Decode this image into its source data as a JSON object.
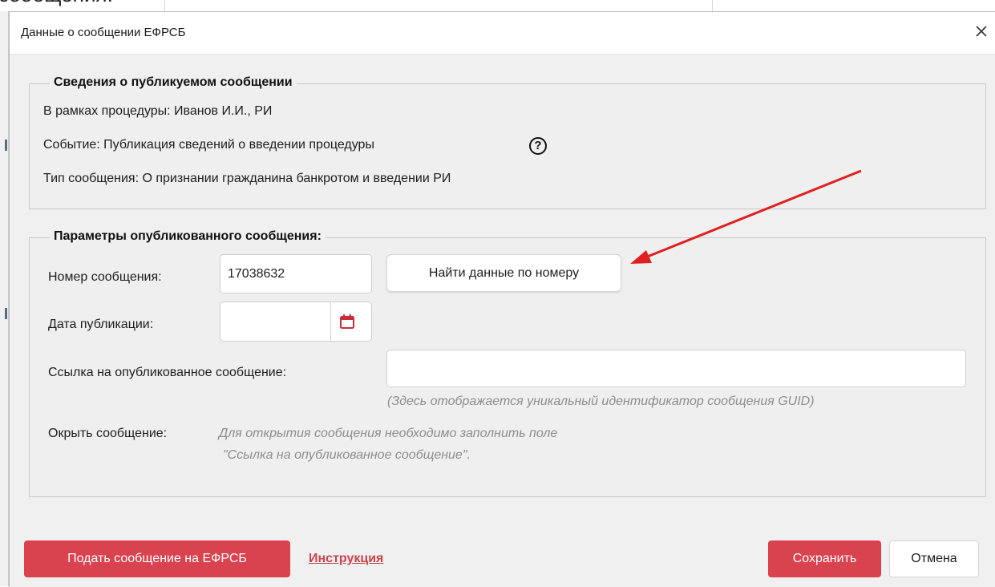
{
  "background": {
    "cut_text": "сообщения:"
  },
  "dialog": {
    "title": "Данные о сообщении ЕФРСБ",
    "close_icon": "close-icon"
  },
  "published_info": {
    "title": "Сведения о публикуемом сообщении",
    "procedure": "В рамках процедуры: Иванов И.И., РИ",
    "event": "Событие:  Публикация сведений о введении процедуры",
    "help_icon": "?",
    "message_type": "Тип сообщения: О признании гражданина банкротом и введении РИ"
  },
  "params": {
    "title": "Параметры опубликованного сообщения:",
    "number_label": "Номер сообщения:",
    "number_value": "17038632",
    "find_button": "Найти данные по номеру",
    "date_label": "Дата публикации:",
    "date_value": "",
    "calendar_icon": "calendar-icon",
    "link_label": "Ссылка на опубликованное сообщение:",
    "link_value": "",
    "link_hint": "(Здесь отображается уникальный идентификатор сообщения GUID)",
    "open_label": "Окрыть сообщение:",
    "open_hint_line1": "Для открытия сообщения необходимо заполнить поле",
    "open_hint_line2": "\"Ссылка на опубликованное сообщение\"."
  },
  "footer": {
    "submit_button": "Подать сообщение на ЕФРСБ",
    "instruction_link": "Инструкция",
    "save_button": "Сохранить",
    "cancel_button": "Отмена"
  },
  "colors": {
    "accent_red": "#d9434f",
    "arrow_red": "#e02020",
    "link_red": "#c9454d",
    "calendar_red": "#cc2b3b"
  }
}
